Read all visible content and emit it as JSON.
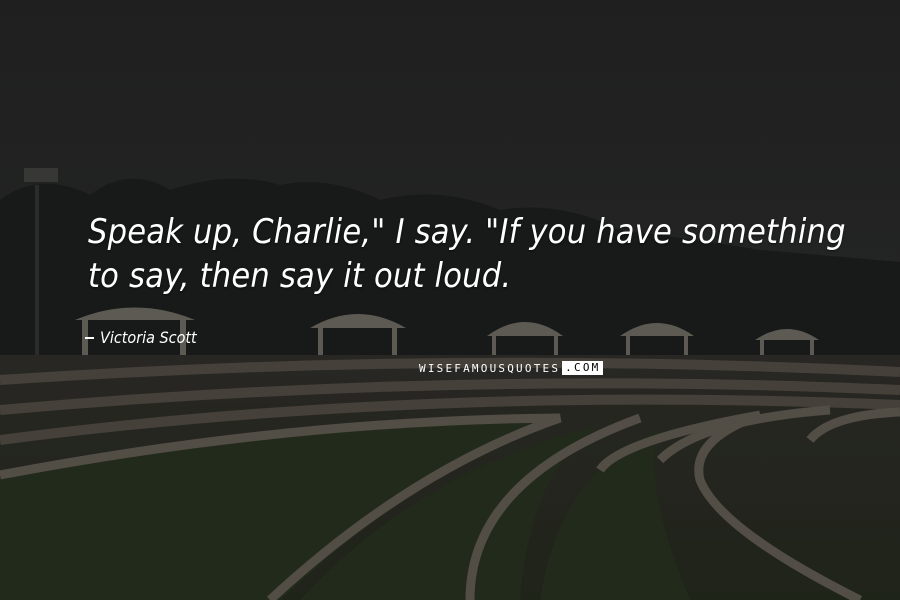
{
  "quote": {
    "text": "Speak up, Charlie,\" I say. \"If you have something to say, then say it out loud.",
    "author": "Victoria Scott"
  },
  "watermark": {
    "left": "WISEFAMOUSQUOTES",
    "right": ".COM"
  },
  "colors": {
    "text": "#ffffff",
    "sky": "#2b2c2b",
    "grass": "#2f3a26"
  }
}
